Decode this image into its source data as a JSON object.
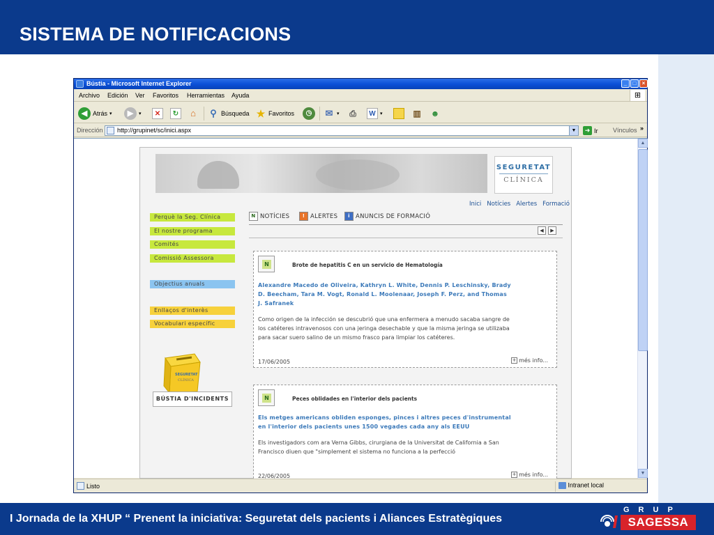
{
  "slide": {
    "title": "SISTEMA DE NOTIFICACIONS",
    "footer": "I Jornada de la XHUP “ Prenent la iniciativa: Seguretat dels pacients i Aliances Estratègiques",
    "logo_top": "GRUP",
    "logo_name": "SAGESSA"
  },
  "browser": {
    "title": "Bústia - Microsoft Internet Explorer",
    "menu": [
      "Archivo",
      "Edición",
      "Ver",
      "Favoritos",
      "Herramientas",
      "Ayuda"
    ],
    "toolbar": {
      "back": "Atrás",
      "search": "Búsqueda",
      "favorites": "Favoritos"
    },
    "address_label": "Dirección",
    "url": "http://grupinet/sc/inici.aspx",
    "go_label": "Ir",
    "links_label": "Vínculos",
    "status": "Listo",
    "zone": "Intranet local"
  },
  "site": {
    "brand_line1": "SEGURETAT",
    "brand_line2": "CLÍNICA",
    "topnav": [
      "Inici",
      "Notícies",
      "Alertes",
      "Formació"
    ],
    "sidenav": [
      {
        "label": "Perquè la Seg. Clínica",
        "color": "#c7e83d"
      },
      {
        "label": "El nostre programa",
        "color": "#c7e83d"
      },
      {
        "label": "Comités",
        "color": "#c7e83d"
      },
      {
        "label": "Comissió Assessora",
        "color": "#c7e83d"
      },
      {
        "label": "Objectius anuals",
        "color": "#8bc4f0"
      },
      {
        "label": "Enllaços d'interès",
        "color": "#f7d13b"
      },
      {
        "label": "Vocabulari específic",
        "color": "#f7d13b"
      }
    ],
    "mailbox_lines": [
      "SEGURETAT",
      "CLÍNICA"
    ],
    "mailbox_button": "BÚSTIA D'INCIDENTS",
    "tabs": [
      "NOTÍCIES",
      "ALERTES",
      "ANUNCIS DE FORMACIÓ"
    ],
    "news": [
      {
        "badge": "N",
        "title": "Brote de hepatitis C en un servicio de Hematología",
        "authors": [
          "Alexandre Macedo de Oliveira, Kathryn L. White, Dennis P. Leschinsky, Brady",
          "D. Beecham, Tara M. Vogt, Ronald L. Moolenaar, Joseph F. Perz, and Thomas",
          "J. Safranek"
        ],
        "body": [
          "Como origen de la infección se descubrió que una enfermera a menudo sacaba sangre de",
          "los catéteres intravenosos con una jeringa desechable y que la misma jeringa se utilizaba",
          "para sacar suero salino de un mismo frasco para limpiar los catéteres."
        ],
        "date": "17/06/2005",
        "more": "més info..."
      },
      {
        "badge": "N",
        "title": "Peces oblidades en l'interior dels pacients",
        "authors": [
          "Els metges americans obliden esponges, pinces i altres peces d'instrumental",
          "en l'interior dels pacients unes 1500 vegades cada any als EEUU"
        ],
        "body": [
          "Els investigadors com ara Verna Gibbs, cirurgiana de la Universitat de California a San",
          "Francisco diuen que \"simplement el sistema no funciona a la perfecció"
        ],
        "date": "22/06/2005",
        "more": "més info..."
      }
    ]
  }
}
